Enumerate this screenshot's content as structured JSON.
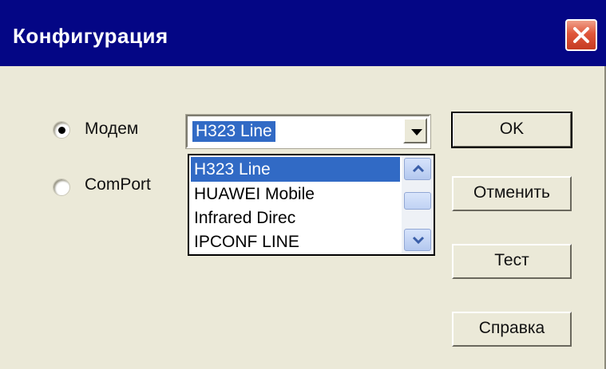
{
  "window": {
    "title": "Конфигурация"
  },
  "radios": [
    {
      "label": "Модем",
      "checked": true
    },
    {
      "label": "ComPort",
      "checked": false
    }
  ],
  "combo": {
    "selected": "H323 Line",
    "options": [
      "H323 Line",
      "HUAWEI Mobile",
      "Infrared Direc",
      "IPCONF LINE"
    ]
  },
  "buttons": {
    "ok": "OK",
    "cancel": "Отменить",
    "test": "Тест",
    "help": "Справка"
  },
  "colors": {
    "title_bar": "#040685",
    "selection": "#316ac5",
    "face": "#ebe9d8"
  },
  "icons": {
    "close": "close-icon",
    "dropdown": "chevron-down-icon",
    "scroll_up": "scroll-up-icon",
    "scroll_down": "scroll-down-icon"
  }
}
